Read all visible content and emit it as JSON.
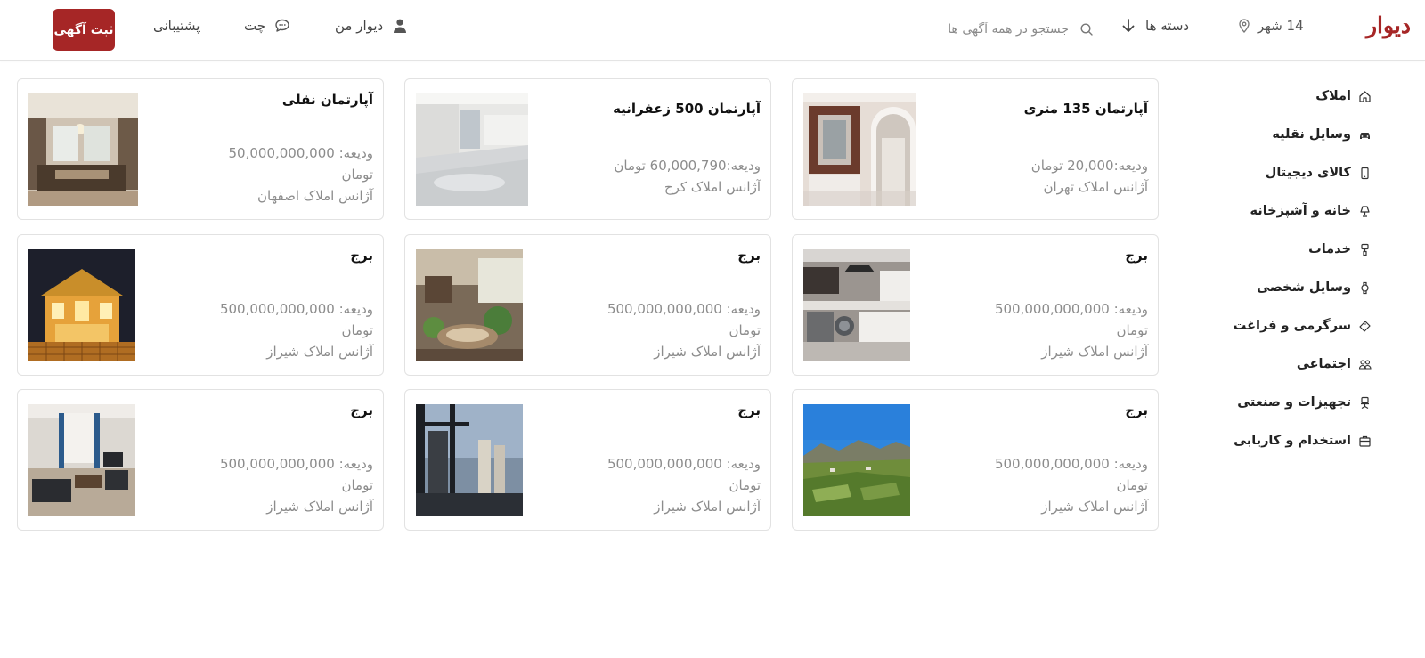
{
  "header": {
    "logo": "دیوار",
    "city": "14 شهر",
    "categories_label": "دسته ها",
    "search_placeholder": "جستجو در همه آگهی ها",
    "my_divar": "دیوار من",
    "chat": "چت",
    "support": "پشتیبانی",
    "post_ad": "ثبت آگهی"
  },
  "colors": {
    "brand": "#a62626",
    "muted_text": "#8c8c8c",
    "border": "#e2e2e2"
  },
  "sidebar": {
    "items": [
      {
        "label": "املاک",
        "icon": "home-icon"
      },
      {
        "label": "وسایل نقلیه",
        "icon": "car-icon"
      },
      {
        "label": "کالای دیجیتال",
        "icon": "phone-icon"
      },
      {
        "label": "خانه و آشپزخانه",
        "icon": "lamp-icon"
      },
      {
        "label": "خدمات",
        "icon": "paint-roller-icon"
      },
      {
        "label": "وسایل شخصی",
        "icon": "watch-icon"
      },
      {
        "label": "سرگرمی و فراغت",
        "icon": "ticket-icon"
      },
      {
        "label": "اجتماعی",
        "icon": "people-icon"
      },
      {
        "label": "تجهیزات و صنعتی",
        "icon": "chair-icon"
      },
      {
        "label": "استخدام و کاریابی",
        "icon": "briefcase-icon"
      }
    ]
  },
  "listings": [
    {
      "title": "آپارتمان 135 متری",
      "price": "ودیعه:20,000 تومان",
      "unit": "",
      "agency": "آژانس املاک تهران",
      "image": "bathroom-mirror-photo"
    },
    {
      "title": "آپارتمان 500 زعفرانیه",
      "price": "ودیعه:60,000,790 تومان",
      "unit": "",
      "agency": "آژانس املاک کرج",
      "image": "empty-apartment-photo"
    },
    {
      "title": "آپارتمان نقلی",
      "price": "ودیعه: 50,000,000,000",
      "unit": "تومان",
      "agency": "آژانس املاک اصفهان",
      "image": "living-room-photo"
    },
    {
      "title": "برج",
      "price": "ودیعه: 500,000,000,000",
      "unit": "تومان",
      "agency": "آژانس املاک شیراز",
      "image": "kitchen-photo"
    },
    {
      "title": "برج",
      "price": "ودیعه: 500,000,000,000",
      "unit": "تومان",
      "agency": "آژانس املاک شیراز",
      "image": "lounge-plants-photo"
    },
    {
      "title": "برج",
      "price": "ودیعه: 500,000,000,000",
      "unit": "تومان",
      "agency": "آژانس املاک شیراز",
      "image": "lit-villa-night-photo"
    },
    {
      "title": "برج",
      "price": "ودیعه: 500,000,000,000",
      "unit": "تومان",
      "agency": "آژانس املاک شیراز",
      "image": "mountain-valley-photo"
    },
    {
      "title": "برج",
      "price": "ودیعه: 500,000,000,000",
      "unit": "تومان",
      "agency": "آژانس املاک شیراز",
      "image": "tower-window-view-photo"
    },
    {
      "title": "برج",
      "price": "ودیعه: 500,000,000,000",
      "unit": "تومان",
      "agency": "آژانس املاک شیراز",
      "image": "furnished-room-photo"
    }
  ]
}
